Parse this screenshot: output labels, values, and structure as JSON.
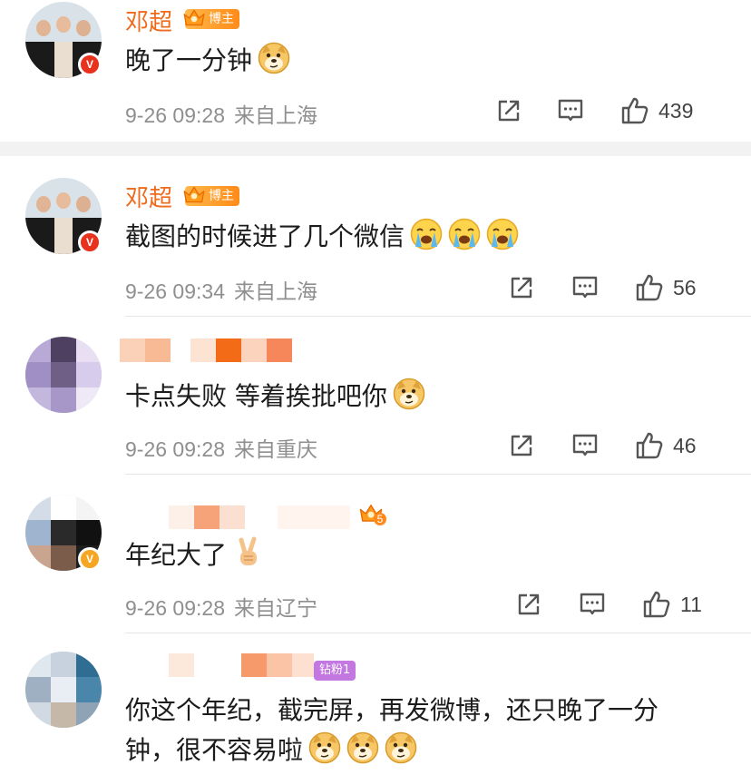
{
  "comments": [
    {
      "name": "邓超",
      "tag": "博主",
      "text": "晚了一分钟",
      "date": "9-26 09:28",
      "source": "来自上海",
      "likes": "439"
    },
    {
      "name": "邓超",
      "tag": "博主",
      "text": "截图的时候进了几个微信",
      "date": "9-26 09:34",
      "source": "来自上海",
      "likes": "56"
    },
    {
      "name": "",
      "text": "卡点失败 等着挨批吧你",
      "date": "9-26 09:28",
      "source": "来自重庆",
      "likes": "46"
    },
    {
      "name": "",
      "level": "5",
      "text": "年纪大了",
      "date": "9-26 09:28",
      "source": "来自辽宁",
      "likes": "11"
    },
    {
      "name": "",
      "fan_tag": "钻粉1",
      "text_line1": "你这个年纪，截完屏，再发微博，还只晚了一分",
      "text_line2": "钟，很不容易啦"
    }
  ],
  "icons": {
    "share": "share-icon",
    "comment": "comment-icon",
    "like": "thumbs-up-icon",
    "emoji_doge": "doge-emoji",
    "emoji_cry": "crying-emoji",
    "emoji_victory": "victory-hand-emoji",
    "verified": "verified-badge-icon",
    "crown": "crown-icon"
  },
  "colors": {
    "username": "#ef6a1b",
    "verified_red": "#e8321e",
    "verified_gold": "#f5a623",
    "meta_text": "#8f8f8f",
    "separator": "#f2f2f2"
  }
}
